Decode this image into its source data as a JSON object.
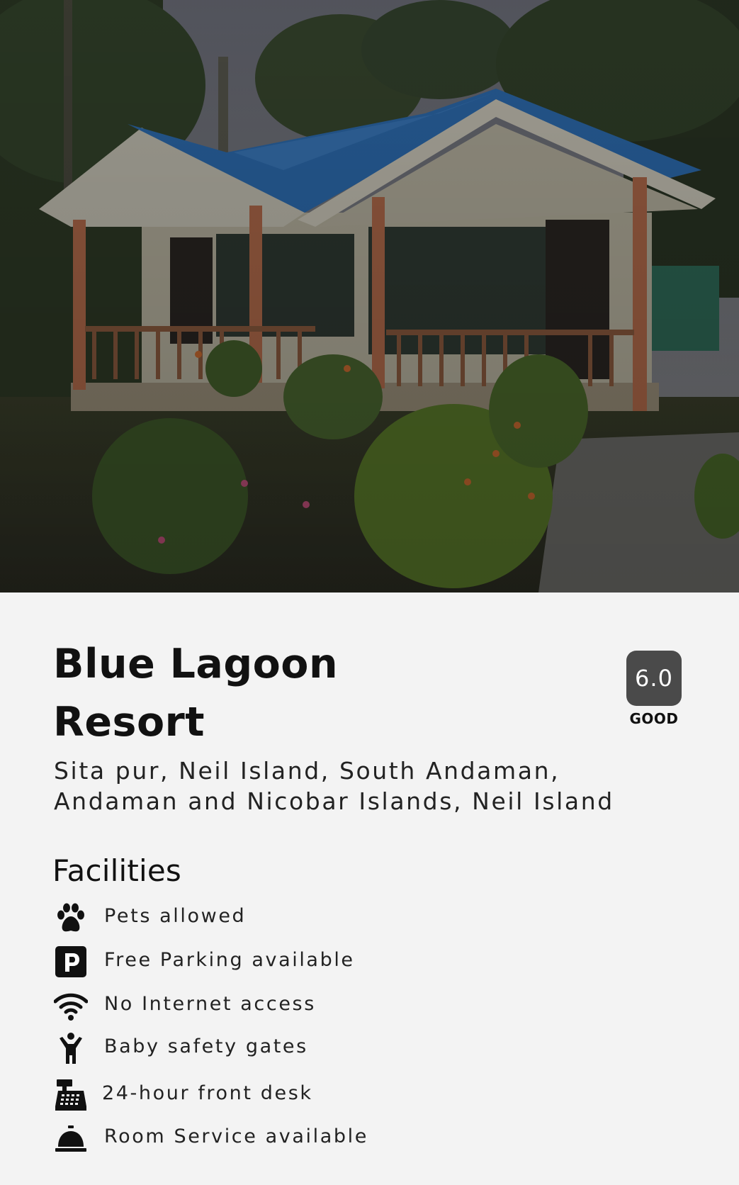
{
  "hotel": {
    "name_line1": "Blue Lagoon",
    "name_line2": "Resort",
    "rating": {
      "score": "6.0",
      "label": "GOOD"
    },
    "address_line1": "Sita pur, Neil Island, South Andaman,",
    "address_line2": "Andaman and Nicobar Islands, Neil Island"
  },
  "facilities": {
    "heading": "Facilities",
    "items": [
      {
        "icon": "paw-icon",
        "label": "Pets allowed"
      },
      {
        "icon": "parking-icon",
        "label": "Free Parking available"
      },
      {
        "icon": "wifi-icon",
        "label": "No Internet access"
      },
      {
        "icon": "child-icon",
        "label": "Baby safety gates"
      },
      {
        "icon": "cash-register-icon",
        "label": "24-hour front desk"
      },
      {
        "icon": "service-bell-icon",
        "label": "Room Service available"
      }
    ]
  },
  "colors": {
    "background": "#f3f3f3",
    "score_badge": "#4a4a4a",
    "roof_blue": "#2e6fb5"
  }
}
